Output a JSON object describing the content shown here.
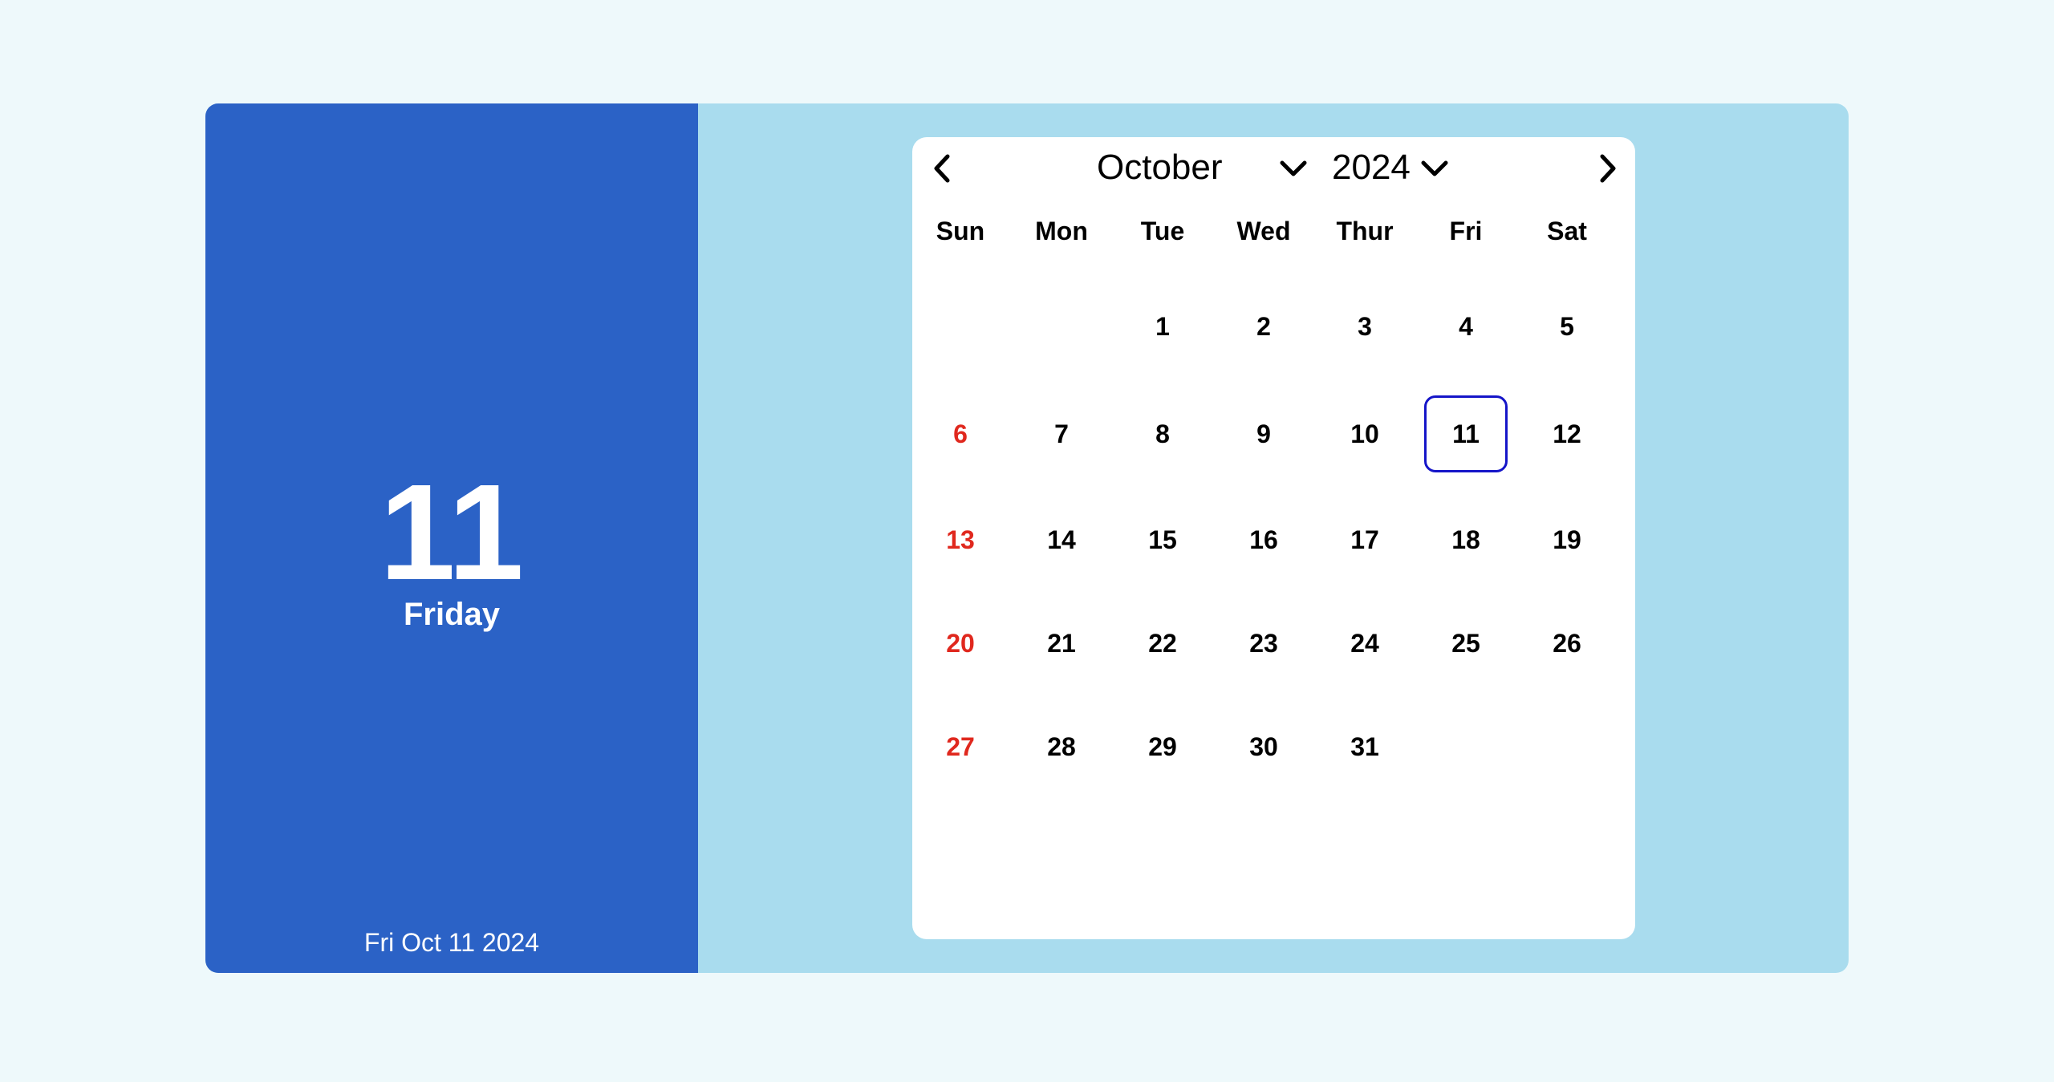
{
  "left_panel": {
    "day_number": "11",
    "weekday_name": "Friday",
    "full_date": "Fri Oct 11 2024"
  },
  "calendar": {
    "prev_icon": "chevron-left-icon",
    "next_icon": "chevron-right-icon",
    "dropdown_icon": "chevron-down-icon",
    "month": "October",
    "year": "2024",
    "weekdays": [
      "Sun",
      "Mon",
      "Tue",
      "Wed",
      "Thur",
      "Fri",
      "Sat"
    ],
    "first_weekday_index": 2,
    "days": [
      "1",
      "2",
      "3",
      "4",
      "5",
      "6",
      "7",
      "8",
      "9",
      "10",
      "11",
      "12",
      "13",
      "14",
      "15",
      "16",
      "17",
      "18",
      "19",
      "20",
      "21",
      "22",
      "23",
      "24",
      "25",
      "26",
      "27",
      "28",
      "29",
      "30",
      "31"
    ],
    "selected_day": "11"
  },
  "colors": {
    "page_background": "#eef9fb",
    "left_panel": "#2b62c6",
    "right_panel": "#a9dcee",
    "sunday_text": "#e0281e",
    "selected_outline": "#1515c8"
  }
}
